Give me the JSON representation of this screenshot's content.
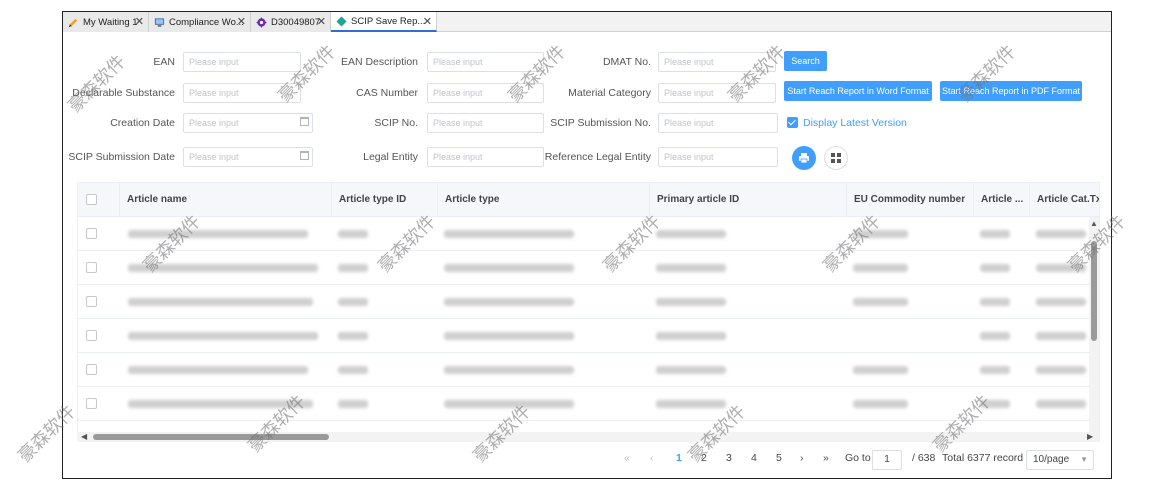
{
  "tabs": [
    {
      "label": "My Waiting 1",
      "icon": "pencil-icon"
    },
    {
      "label": "Compliance Wo...",
      "icon": "monitor-icon"
    },
    {
      "label": "D30049807",
      "icon": "gear-icon"
    },
    {
      "label": "SCIP Save Rep...",
      "icon": "diamond-icon",
      "active": true
    }
  ],
  "form": {
    "placeholder": "Please input",
    "ean": "EAN",
    "ean_description": "EAN Description",
    "dmat_no": "DMAT No.",
    "declarable_substance": "Declarable Substance",
    "cas_number": "CAS Number",
    "material_category": "Material Category",
    "creation_date": "Creation Date",
    "scip_no": "SCIP No.",
    "scip_submission_no": "SCIP Submission No.",
    "scip_submission_date": "SCIP Submission Date",
    "legal_entity": "Legal Entity",
    "reference_legal_entity": "Reference Legal Entity"
  },
  "buttons": {
    "search": "Search",
    "word": "Start Reach Report in Word Format",
    "pdf": "Start Reach Report in PDF Format"
  },
  "display_latest": {
    "label": "Display Latest Version",
    "checked": true
  },
  "table": {
    "columns": [
      "Article name",
      "Article type ID",
      "Article type",
      "Primary article ID",
      "EU Commodity number",
      "Article ...",
      "Article Cat.Txt"
    ]
  },
  "pagination": {
    "pages": [
      "1",
      "2",
      "3",
      "4",
      "5"
    ],
    "current": "1",
    "goto_label": "Go to",
    "goto_value": "1",
    "total_pages": "/ 638",
    "total_records": "Total 6377 record",
    "page_size": "10/page"
  },
  "watermark": "豪森软件",
  "colors": {
    "accent": "#409eff",
    "tab_active": "#2d6fd6"
  }
}
